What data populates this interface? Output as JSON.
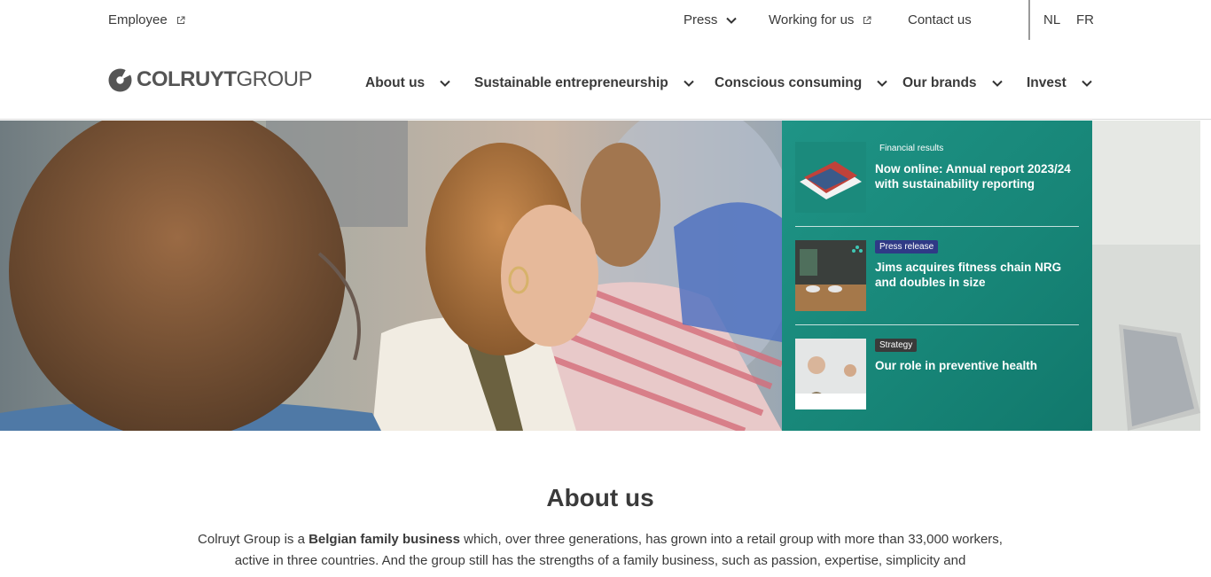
{
  "utility": {
    "employee": "Employee",
    "press": "Press",
    "working_for_us": "Working for us",
    "contact_us": "Contact us",
    "lang_nl": "NL",
    "lang_fr": "FR"
  },
  "logo": {
    "bold": "COLRUYT",
    "light": "GROUP"
  },
  "nav": [
    {
      "label": "About us"
    },
    {
      "label": "Sustainable entrepreneurship"
    },
    {
      "label": "Conscious consuming"
    },
    {
      "label": "Our brands"
    },
    {
      "label": "Invest"
    }
  ],
  "news": [
    {
      "tag": "Financial results",
      "title": "Now online: Annual report 2023/24 with sustainability reporting"
    },
    {
      "tag": "Press release",
      "title": "Jims acquires fitness chain NRG and doubles in size"
    },
    {
      "tag": "Strategy",
      "title": "Our role in preventive health"
    }
  ],
  "about": {
    "title": "About us",
    "intro_pre": "Colruyt Group is a ",
    "intro_bold": "Belgian family business",
    "intro_post": " which, over three generations, has grown into a retail group with more than 33,000 workers, active in three countries. And the group still has the strengths of a family business, such as passion, expertise, simplicity and"
  },
  "colors": {
    "teal_panel": "#178577",
    "tag_press_release": "#2f3a86",
    "tag_strategy": "#3a3a3a",
    "text": "#3a3a3a"
  }
}
